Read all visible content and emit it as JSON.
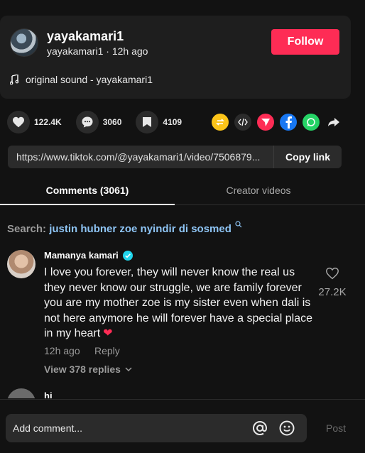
{
  "post": {
    "username": "yayakamari1",
    "handle": "yayakamari1",
    "time": "12h ago",
    "follow_label": "Follow",
    "sound": "original sound - yayakamari1"
  },
  "actions": {
    "likes": "122.4K",
    "comments": "3060",
    "saves": "4109"
  },
  "share_icons": [
    "repost-icon",
    "embed-icon",
    "send-icon",
    "facebook-icon",
    "whatsapp-icon",
    "share-arrow-icon"
  ],
  "link": {
    "url": "https://www.tiktok.com/@yayakamari1/video/7506879...",
    "copy_label": "Copy link"
  },
  "tabs": {
    "comments": "Comments (3061)",
    "creator": "Creator videos"
  },
  "search": {
    "prefix": "Search: ",
    "query": "justin hubner zoe nyindir di sosmed"
  },
  "comment": {
    "user": "Mamanya kamari",
    "text": "I love you forever, they will never know the real us they never know our struggle, we are family forever you are my mother zoe is my sister even when dali is not here anymore he will forever have a special place in my heart",
    "heart": "❤",
    "likes": "27.2K",
    "time": "12h ago",
    "reply_label": "Reply",
    "view_replies": "View 378 replies"
  },
  "comment2": {
    "user": "hi"
  },
  "composer": {
    "placeholder": "Add comment...",
    "post_label": "Post"
  },
  "colors": {
    "accent": "#fe2c55",
    "background": "#121212",
    "card": "#1e1e1e",
    "verified": "#20d5ec",
    "search_query": "#8ec4f4"
  }
}
